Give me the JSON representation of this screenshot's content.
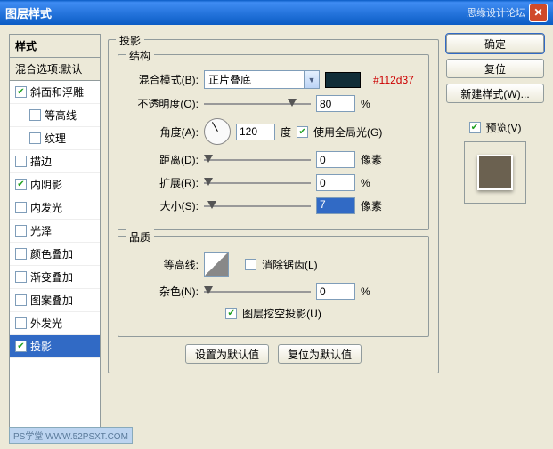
{
  "title": "图层样式",
  "watermark1": "思缘设计论坛",
  "watermark2": "PS学堂  WWW.52PSXT.COM",
  "styles": {
    "header": "样式",
    "subheader": "混合选项:默认",
    "items": [
      {
        "label": "斜面和浮雕",
        "checked": true,
        "indent": false
      },
      {
        "label": "等高线",
        "checked": false,
        "indent": true
      },
      {
        "label": "纹理",
        "checked": false,
        "indent": true
      },
      {
        "label": "描边",
        "checked": false,
        "indent": false
      },
      {
        "label": "内阴影",
        "checked": true,
        "indent": false
      },
      {
        "label": "内发光",
        "checked": false,
        "indent": false
      },
      {
        "label": "光泽",
        "checked": false,
        "indent": false
      },
      {
        "label": "颜色叠加",
        "checked": false,
        "indent": false
      },
      {
        "label": "渐变叠加",
        "checked": false,
        "indent": false
      },
      {
        "label": "图案叠加",
        "checked": false,
        "indent": false
      },
      {
        "label": "外发光",
        "checked": false,
        "indent": false
      },
      {
        "label": "投影",
        "checked": true,
        "indent": false,
        "selected": true
      }
    ]
  },
  "panel": {
    "title": "投影",
    "structure": {
      "title": "结构",
      "blend": {
        "label": "混合模式(B):",
        "value": "正片叠底",
        "color": "#112d37",
        "annot": "#112d37"
      },
      "opacity": {
        "label": "不透明度(O):",
        "value": "80",
        "unit": "%"
      },
      "angle": {
        "label": "角度(A):",
        "value": "120",
        "unit": "度",
        "globalLabel": "使用全局光(G)",
        "globalChecked": true
      },
      "distance": {
        "label": "距离(D):",
        "value": "0",
        "unit": "像素"
      },
      "spread": {
        "label": "扩展(R):",
        "value": "0",
        "unit": "%"
      },
      "size": {
        "label": "大小(S):",
        "value": "7",
        "unit": "像素"
      }
    },
    "quality": {
      "title": "品质",
      "contour": {
        "label": "等高线:",
        "antiLabel": "消除锯齿(L)",
        "antiChecked": false
      },
      "noise": {
        "label": "杂色(N):",
        "value": "0",
        "unit": "%"
      },
      "knockout": {
        "label": "图层挖空投影(U)",
        "checked": true
      }
    },
    "buttons": {
      "makeDefault": "设置为默认值",
      "resetDefault": "复位为默认值"
    }
  },
  "right": {
    "ok": "确定",
    "cancel": "复位",
    "newStyle": "新建样式(W)...",
    "preview": {
      "label": "预览(V)",
      "checked": true
    }
  }
}
